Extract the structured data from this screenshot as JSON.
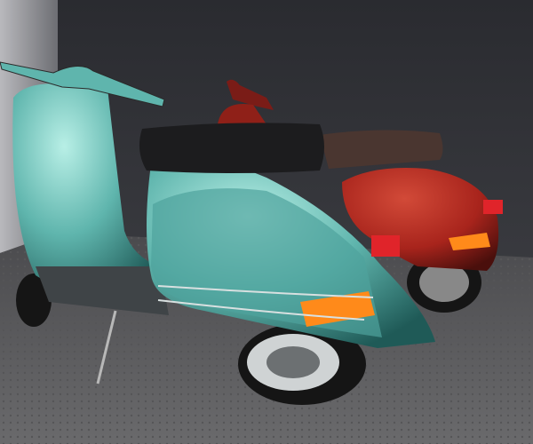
{
  "scene": {
    "subject": "two scooters",
    "colors": {
      "teal_body": "#5fb5ad",
      "red_body": "#a8241c",
      "seat": "#1c1c1e",
      "floor": "#5e5e60",
      "wall": "#2d2e33",
      "indicator": "#ff8a1a",
      "tail_light": "#e0242a"
    }
  }
}
